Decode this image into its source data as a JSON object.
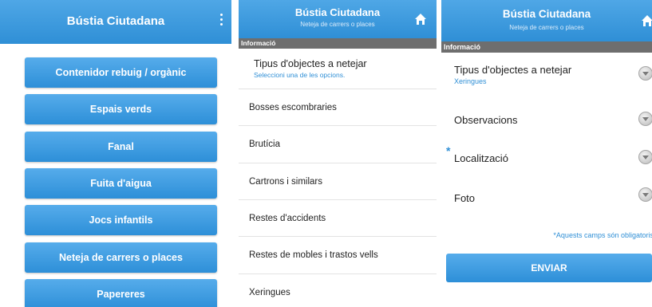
{
  "app": {
    "title": "Bústia Ciutadana",
    "subtitle": "Neteja de carrers o places"
  },
  "screen1": {
    "categories": [
      "Contenidor rebuig / orgànic",
      "Espais verds",
      "Fanal",
      "Fuita d'aigua",
      "Jocs infantils",
      "Neteja de carrers o places",
      "Papereres"
    ]
  },
  "screen2": {
    "section": "Informació",
    "field_label": "Tipus d'objectes a netejar",
    "field_hint": "Seleccioni una de les opcions.",
    "options": [
      "Bosses escombraries",
      "Brutícia",
      "Cartrons i similars",
      "Restes d'accidents",
      "Restes de mobles i trastos vells",
      "Xeringues"
    ]
  },
  "screen3": {
    "section": "Informació",
    "fields": [
      {
        "label": "Tipus d'objectes a netejar",
        "value": "Xeringues"
      },
      {
        "label": "Observacions",
        "value": ""
      },
      {
        "label": "Localització",
        "value": ""
      },
      {
        "label": "Foto",
        "value": ""
      }
    ],
    "required_star": "*",
    "required_note": "*Aquests camps són obligatoris",
    "submit_label": "ENVIAR"
  },
  "colors": {
    "accent": "#2f8fd6",
    "section_bar": "#6e6e6e"
  },
  "icons": [
    "more-vert-icon",
    "home-icon",
    "dropdown-chevron-icon"
  ]
}
